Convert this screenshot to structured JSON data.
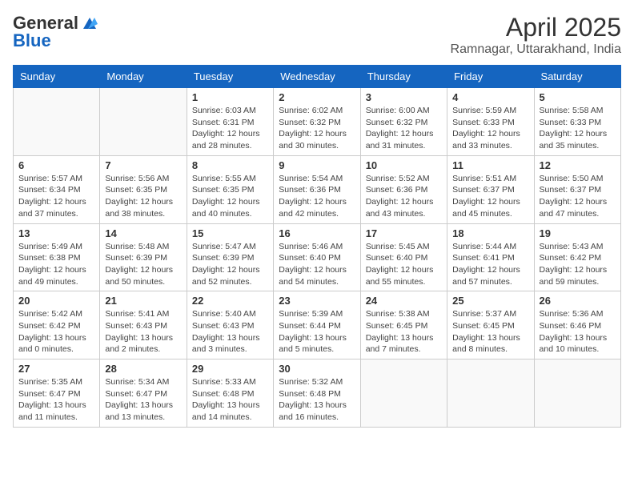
{
  "header": {
    "logo_general": "General",
    "logo_blue": "Blue",
    "title": "April 2025",
    "subtitle": "Ramnagar, Uttarakhand, India"
  },
  "days_of_week": [
    "Sunday",
    "Monday",
    "Tuesday",
    "Wednesday",
    "Thursday",
    "Friday",
    "Saturday"
  ],
  "weeks": [
    [
      {
        "day": "",
        "info": ""
      },
      {
        "day": "",
        "info": ""
      },
      {
        "day": "1",
        "info": "Sunrise: 6:03 AM\nSunset: 6:31 PM\nDaylight: 12 hours\nand 28 minutes."
      },
      {
        "day": "2",
        "info": "Sunrise: 6:02 AM\nSunset: 6:32 PM\nDaylight: 12 hours\nand 30 minutes."
      },
      {
        "day": "3",
        "info": "Sunrise: 6:00 AM\nSunset: 6:32 PM\nDaylight: 12 hours\nand 31 minutes."
      },
      {
        "day": "4",
        "info": "Sunrise: 5:59 AM\nSunset: 6:33 PM\nDaylight: 12 hours\nand 33 minutes."
      },
      {
        "day": "5",
        "info": "Sunrise: 5:58 AM\nSunset: 6:33 PM\nDaylight: 12 hours\nand 35 minutes."
      }
    ],
    [
      {
        "day": "6",
        "info": "Sunrise: 5:57 AM\nSunset: 6:34 PM\nDaylight: 12 hours\nand 37 minutes."
      },
      {
        "day": "7",
        "info": "Sunrise: 5:56 AM\nSunset: 6:35 PM\nDaylight: 12 hours\nand 38 minutes."
      },
      {
        "day": "8",
        "info": "Sunrise: 5:55 AM\nSunset: 6:35 PM\nDaylight: 12 hours\nand 40 minutes."
      },
      {
        "day": "9",
        "info": "Sunrise: 5:54 AM\nSunset: 6:36 PM\nDaylight: 12 hours\nand 42 minutes."
      },
      {
        "day": "10",
        "info": "Sunrise: 5:52 AM\nSunset: 6:36 PM\nDaylight: 12 hours\nand 43 minutes."
      },
      {
        "day": "11",
        "info": "Sunrise: 5:51 AM\nSunset: 6:37 PM\nDaylight: 12 hours\nand 45 minutes."
      },
      {
        "day": "12",
        "info": "Sunrise: 5:50 AM\nSunset: 6:37 PM\nDaylight: 12 hours\nand 47 minutes."
      }
    ],
    [
      {
        "day": "13",
        "info": "Sunrise: 5:49 AM\nSunset: 6:38 PM\nDaylight: 12 hours\nand 49 minutes."
      },
      {
        "day": "14",
        "info": "Sunrise: 5:48 AM\nSunset: 6:39 PM\nDaylight: 12 hours\nand 50 minutes."
      },
      {
        "day": "15",
        "info": "Sunrise: 5:47 AM\nSunset: 6:39 PM\nDaylight: 12 hours\nand 52 minutes."
      },
      {
        "day": "16",
        "info": "Sunrise: 5:46 AM\nSunset: 6:40 PM\nDaylight: 12 hours\nand 54 minutes."
      },
      {
        "day": "17",
        "info": "Sunrise: 5:45 AM\nSunset: 6:40 PM\nDaylight: 12 hours\nand 55 minutes."
      },
      {
        "day": "18",
        "info": "Sunrise: 5:44 AM\nSunset: 6:41 PM\nDaylight: 12 hours\nand 57 minutes."
      },
      {
        "day": "19",
        "info": "Sunrise: 5:43 AM\nSunset: 6:42 PM\nDaylight: 12 hours\nand 59 minutes."
      }
    ],
    [
      {
        "day": "20",
        "info": "Sunrise: 5:42 AM\nSunset: 6:42 PM\nDaylight: 13 hours\nand 0 minutes."
      },
      {
        "day": "21",
        "info": "Sunrise: 5:41 AM\nSunset: 6:43 PM\nDaylight: 13 hours\nand 2 minutes."
      },
      {
        "day": "22",
        "info": "Sunrise: 5:40 AM\nSunset: 6:43 PM\nDaylight: 13 hours\nand 3 minutes."
      },
      {
        "day": "23",
        "info": "Sunrise: 5:39 AM\nSunset: 6:44 PM\nDaylight: 13 hours\nand 5 minutes."
      },
      {
        "day": "24",
        "info": "Sunrise: 5:38 AM\nSunset: 6:45 PM\nDaylight: 13 hours\nand 7 minutes."
      },
      {
        "day": "25",
        "info": "Sunrise: 5:37 AM\nSunset: 6:45 PM\nDaylight: 13 hours\nand 8 minutes."
      },
      {
        "day": "26",
        "info": "Sunrise: 5:36 AM\nSunset: 6:46 PM\nDaylight: 13 hours\nand 10 minutes."
      }
    ],
    [
      {
        "day": "27",
        "info": "Sunrise: 5:35 AM\nSunset: 6:47 PM\nDaylight: 13 hours\nand 11 minutes."
      },
      {
        "day": "28",
        "info": "Sunrise: 5:34 AM\nSunset: 6:47 PM\nDaylight: 13 hours\nand 13 minutes."
      },
      {
        "day": "29",
        "info": "Sunrise: 5:33 AM\nSunset: 6:48 PM\nDaylight: 13 hours\nand 14 minutes."
      },
      {
        "day": "30",
        "info": "Sunrise: 5:32 AM\nSunset: 6:48 PM\nDaylight: 13 hours\nand 16 minutes."
      },
      {
        "day": "",
        "info": ""
      },
      {
        "day": "",
        "info": ""
      },
      {
        "day": "",
        "info": ""
      }
    ]
  ]
}
